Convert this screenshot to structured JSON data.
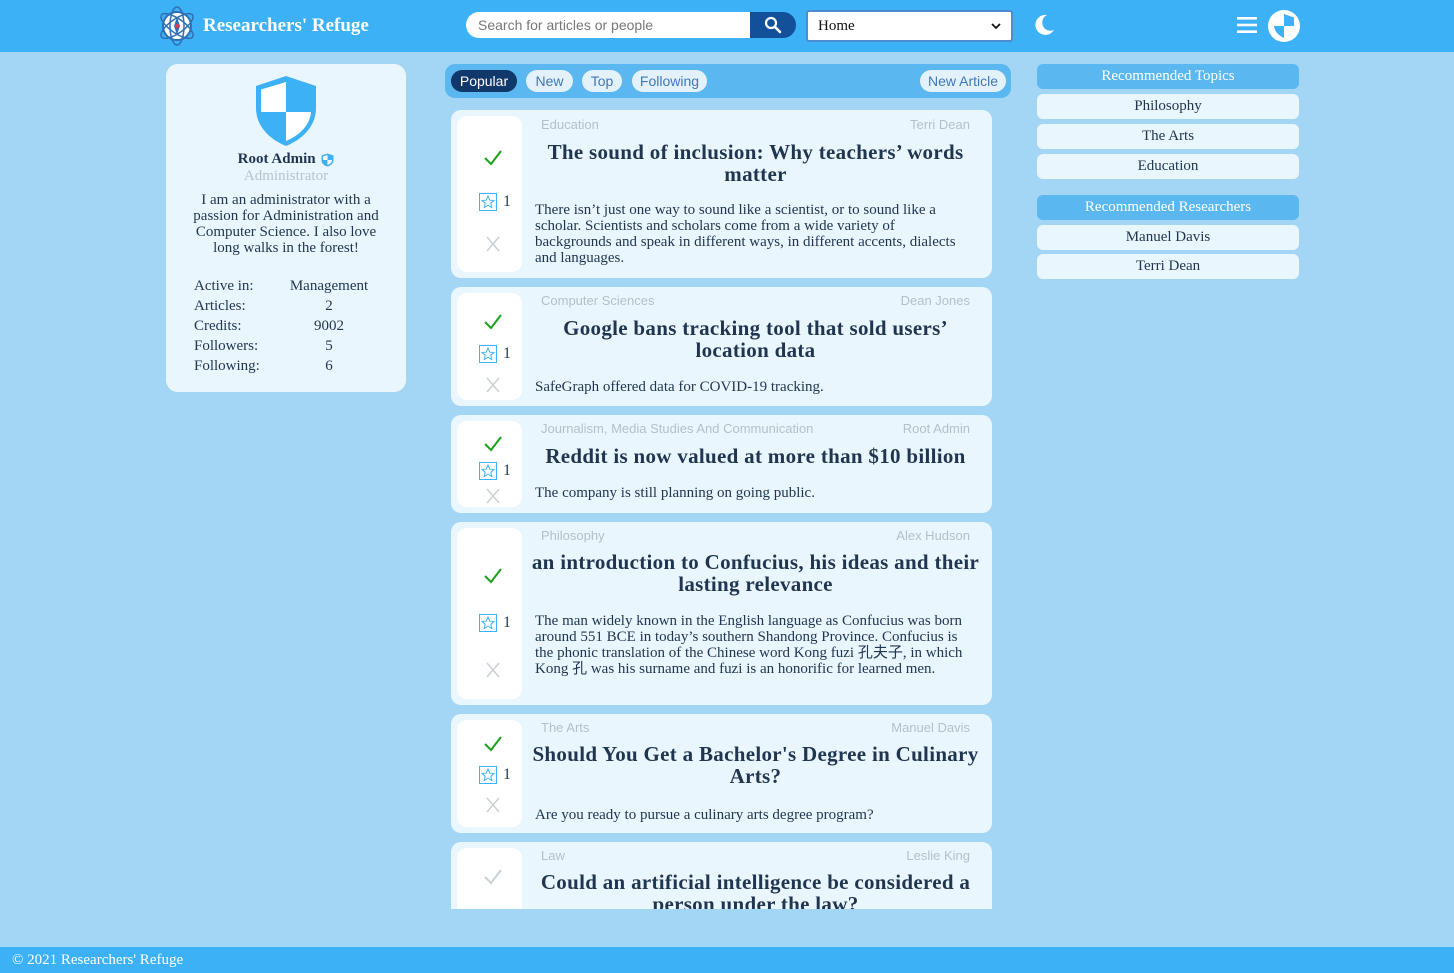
{
  "header": {
    "brand_name": "Researchers' Refuge",
    "search_placeholder": "Search for articles or people",
    "view_select": "Home"
  },
  "profile": {
    "name": "Root Admin",
    "role": "Administrator",
    "bio": "I am an administrator with a passion for Administration and Computer Science. I also love long walks in the forest!",
    "stats": [
      {
        "label": "Active in:",
        "value": "Management"
      },
      {
        "label": "Articles:",
        "value": "2"
      },
      {
        "label": "Credits:",
        "value": "9002"
      },
      {
        "label": "Followers:",
        "value": "5"
      },
      {
        "label": "Following:",
        "value": "6"
      }
    ]
  },
  "feed": {
    "tabs": [
      "Popular",
      "New",
      "Top",
      "Following"
    ],
    "active_tab": "Popular",
    "new_article_label": "New Article",
    "articles": [
      {
        "topic": "Education",
        "author": "Terri Dean",
        "title": "The sound of inclusion: Why teachers’ words matter",
        "description": "There isn’t just one way to sound like a scientist, or to sound like a scholar. Scientists and scholars come from a wide variety of backgrounds and speak in different ways, in different accents, dialects and languages.",
        "favorites": "1"
      },
      {
        "topic": "Computer Sciences",
        "author": "Dean Jones",
        "title": "Google bans tracking tool that sold users’ location data",
        "description": "SafeGraph offered data for COVID-19 tracking.",
        "favorites": "1"
      },
      {
        "topic": "Journalism, Media Studies And Communication",
        "author": "Root Admin",
        "title": "Reddit is now valued at more than $10 billion",
        "description": "The company is still planning on going public.",
        "favorites": "1"
      },
      {
        "topic": "Philosophy",
        "author": "Alex Hudson",
        "title": "an introduction to Confucius, his ideas and their lasting relevance",
        "description": "The man widely known in the English language as Confucius was born around 551 BCE in today’s southern Shandong Province. Confucius is the phonic translation of the Chinese word Kong fuzi 孔夫子, in which Kong 孔 was his surname and fuzi is an honorific for learned men.",
        "favorites": "1"
      },
      {
        "topic": "The Arts",
        "author": "Manuel Davis",
        "title": "Should You Get a Bachelor's Degree in Culinary Arts?",
        "description": "Are you ready to pursue a culinary arts degree program?",
        "favorites": "1"
      },
      {
        "topic": "Law",
        "author": "Leslie King",
        "title": "Could an artificial intelligence be considered a person under the law?",
        "description": "",
        "favorites": ""
      }
    ]
  },
  "sidebar": {
    "topics_heading": "Recommended Topics",
    "topics": [
      "Philosophy",
      "The Arts",
      "Education"
    ],
    "researchers_heading": "Recommended Researchers",
    "researchers": [
      "Manuel Davis",
      "Terri Dean"
    ]
  },
  "footer": {
    "text": "© 2021 Researchers' Refuge"
  },
  "colors": {
    "header": "#3cb1f5",
    "background": "#a3d5f5",
    "card": "#eaf6fd",
    "accent": "#5ab7ef",
    "active_tab": "#11386b",
    "check": "#1aa21a"
  },
  "icons": {
    "logo": "atom-compass-logo",
    "search": "search-icon",
    "moon": "moon-icon",
    "menu": "hamburger-icon",
    "avatar": "shield-icon",
    "approve": "check-icon",
    "favorite": "star-icon",
    "reject": "close-icon"
  }
}
